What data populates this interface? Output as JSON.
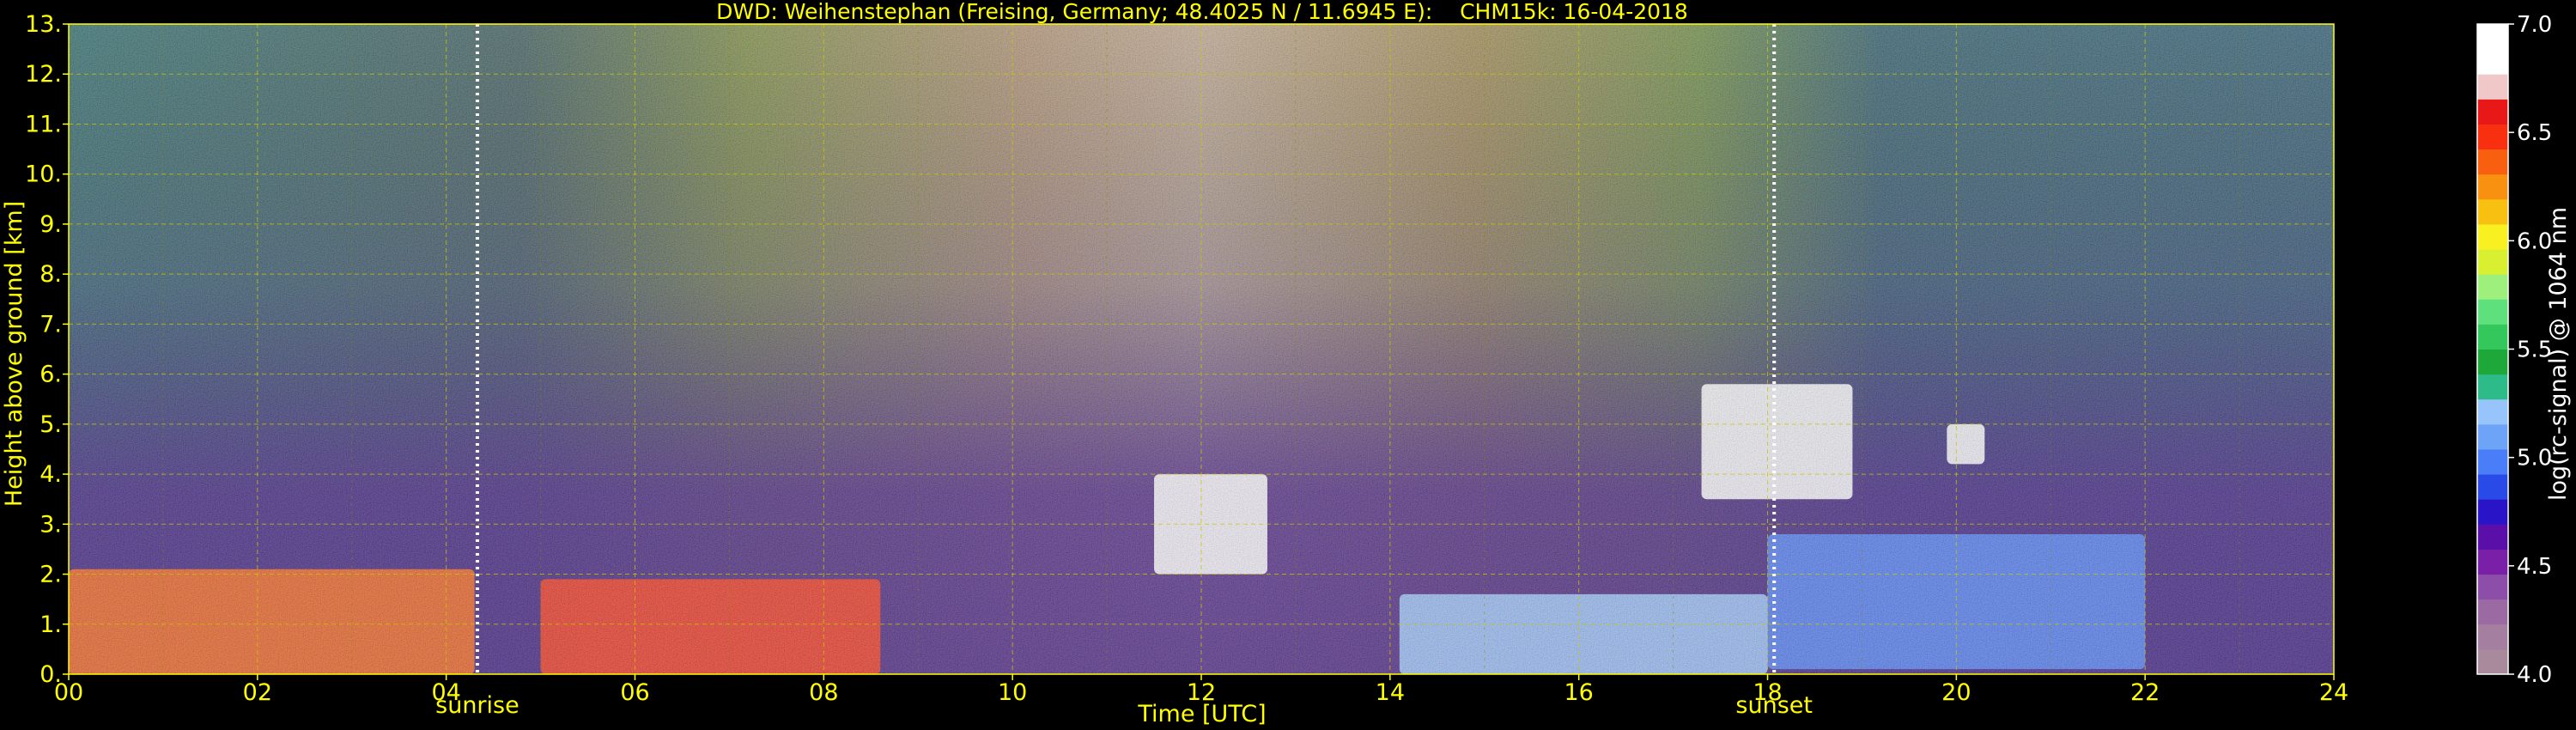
{
  "chart_data": {
    "type": "heatmap",
    "title": "DWD: Weihenstephan (Freising, Germany; 48.4025 N / 11.6945 E):    CHM15k: 16-04-2018",
    "xlabel": "Time [UTC]",
    "ylabel": "Height above ground [km]",
    "xlim": [
      0,
      24
    ],
    "ylim": [
      0,
      13
    ],
    "x_ticks": [
      "00",
      "02",
      "04",
      "06",
      "08",
      "10",
      "12",
      "14",
      "16",
      "18",
      "20",
      "22",
      "24"
    ],
    "y_ticks": [
      "0.",
      "1.",
      "2.",
      "3.",
      "4.",
      "5.",
      "6.",
      "7.",
      "8.",
      "9.",
      "10.",
      "11.",
      "12.",
      "13."
    ],
    "grid": true,
    "markers": [
      {
        "label": "sunrise",
        "x": 4.33
      },
      {
        "label": "sunset",
        "x": 18.07
      }
    ],
    "colorbar": {
      "label": "log(rc-signal) @ 1064 nm",
      "range": [
        4.0,
        7.0
      ],
      "ticks": [
        "4.0",
        "4.5",
        "5.0",
        "5.5",
        "6.0",
        "6.5",
        "7.0"
      ],
      "colors": [
        "#a98a9c",
        "#a47fa0",
        "#9b6aa3",
        "#8c4ea8",
        "#7a20a8",
        "#5a10a8",
        "#2a14c8",
        "#2a4ae8",
        "#4a7ef8",
        "#6ea4f8",
        "#98c4fc",
        "#2ebb8a",
        "#1ea83a",
        "#34c85c",
        "#5ee07c",
        "#9ef07c",
        "#d8f030",
        "#f8f020",
        "#f8c010",
        "#f89010",
        "#f86010",
        "#f83010",
        "#e81818",
        "#f0c8c8",
        "#ffffff",
        "#ffffff"
      ]
    },
    "regions": [
      {
        "x": [
          0.0,
          4.3
        ],
        "y": [
          0.0,
          2.1
        ],
        "level": 6.4
      },
      {
        "x": [
          5.0,
          8.6
        ],
        "y": [
          0.0,
          1.9
        ],
        "level": 6.5
      },
      {
        "x": [
          11.5,
          12.7
        ],
        "y": [
          2.0,
          4.0
        ],
        "level": 7.0
      },
      {
        "x": [
          14.1,
          18.0
        ],
        "y": [
          0.0,
          1.6
        ],
        "level": 5.2
      },
      {
        "x": [
          17.3,
          18.9
        ],
        "y": [
          3.5,
          5.8
        ],
        "level": 7.0
      },
      {
        "x": [
          18.0,
          22.0
        ],
        "y": [
          0.1,
          2.8
        ],
        "level": 5.0
      },
      {
        "x": [
          19.9,
          20.3
        ],
        "y": [
          4.2,
          5.0
        ],
        "level": 6.8
      }
    ]
  }
}
